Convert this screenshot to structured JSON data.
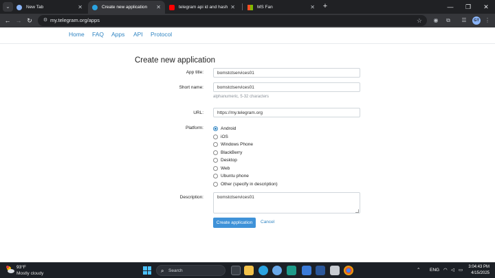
{
  "browser": {
    "tabs": [
      {
        "label": "New Tab",
        "favicon_color": "#8ab4f8",
        "active": false
      },
      {
        "label": "Create new application",
        "favicon_color": "#2aa3e1",
        "active": true
      },
      {
        "label": "telegram api id and hash | How",
        "favicon_color": "#ff0000",
        "active": false
      },
      {
        "label": "MS Fan",
        "favicon_color": "#00a4ef",
        "active": false
      }
    ],
    "new_tab_icon": "+",
    "url": "my.telegram.org/apps"
  },
  "site_nav": [
    "Home",
    "FAQ",
    "Apps",
    "API",
    "Protocol"
  ],
  "form": {
    "title": "Create new application",
    "app_title": {
      "label": "App title:",
      "value": "bomstctservices01"
    },
    "short_name": {
      "label": "Short name:",
      "value": "bomstctservices01",
      "hint": "alphanumeric, 5-32 characters"
    },
    "url": {
      "label": "URL:",
      "value": "https://my.telegram.org"
    },
    "platform": {
      "label": "Platform:",
      "options": [
        "Android",
        "iOS",
        "Windows Phone",
        "BlackBerry",
        "Desktop",
        "Web",
        "Ubuntu phone",
        "Other (specify in description)"
      ],
      "selected": "Android"
    },
    "description": {
      "label": "Description:",
      "value": "bomstctservices01"
    },
    "submit_label": "Create application",
    "cancel_label": "Cancel"
  },
  "taskbar": {
    "weather_temp": "93°F",
    "weather_desc": "Mostly cloudy",
    "search_label": "Search",
    "language": "ENG",
    "time": "3:04:43 PM",
    "date": "4/15/2025"
  },
  "colors": {
    "link": "#2f84c2",
    "primary_button": "#3f92d8",
    "tab_bar": "#202124",
    "taskbar": "#1c2026"
  }
}
